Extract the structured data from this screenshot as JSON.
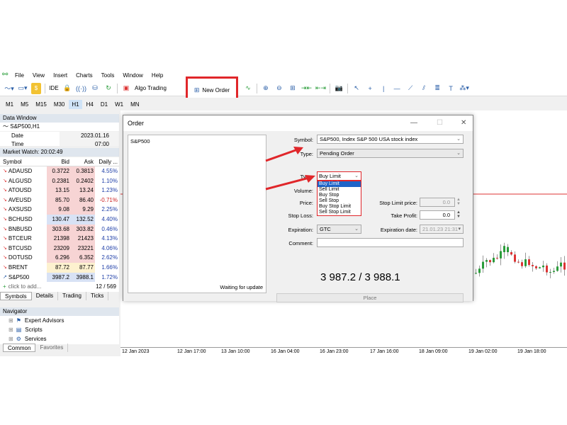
{
  "menu": [
    "File",
    "View",
    "Insert",
    "Charts",
    "Tools",
    "Window",
    "Help"
  ],
  "toolbar": {
    "ide_label": "IDE",
    "algo_label": "Algo Trading",
    "new_order_label": "New Order"
  },
  "timeframes": [
    "M1",
    "M5",
    "M15",
    "M30",
    "H1",
    "H4",
    "D1",
    "W1",
    "MN"
  ],
  "data_window": {
    "title": "Data Window",
    "symbol": "S&P500,H1",
    "rows": [
      {
        "k": "Date",
        "v": "2023.01.16"
      },
      {
        "k": "Time",
        "v": "07:00"
      }
    ]
  },
  "market_watch": {
    "title": "Market Watch: 20:02:49",
    "headers": {
      "symbol": "Symbol",
      "bid": "Bid",
      "ask": "Ask",
      "daily": "Daily ..."
    },
    "rows": [
      {
        "symbol": "ADAUSD",
        "bid": "0.3722",
        "ask": "0.3813",
        "daily": "4.55%",
        "dir": "down",
        "bg": "red"
      },
      {
        "symbol": "ALGUSD",
        "bid": "0.2381",
        "ask": "0.2402",
        "daily": "1.10%",
        "dir": "down",
        "bg": "red"
      },
      {
        "symbol": "ATOUSD",
        "bid": "13.15",
        "ask": "13.24",
        "daily": "1.23%",
        "dir": "down",
        "bg": "red"
      },
      {
        "symbol": "AVEUSD",
        "bid": "85.70",
        "ask": "86.40",
        "daily": "-0.71%",
        "dir": "down",
        "bg": "red"
      },
      {
        "symbol": "AXSUSD",
        "bid": "9.08",
        "ask": "9.29",
        "daily": "2.25%",
        "dir": "down",
        "bg": "red"
      },
      {
        "symbol": "BCHUSD",
        "bid": "130.47",
        "ask": "132.52",
        "daily": "4.40%",
        "dir": "down",
        "bg": "blue"
      },
      {
        "symbol": "BNBUSD",
        "bid": "303.68",
        "ask": "303.82",
        "daily": "0.46%",
        "dir": "down",
        "bg": "red"
      },
      {
        "symbol": "BTCEUR",
        "bid": "21398",
        "ask": "21423",
        "daily": "4.13%",
        "dir": "down",
        "bg": "red"
      },
      {
        "symbol": "BTCUSD",
        "bid": "23209",
        "ask": "23221",
        "daily": "4.06%",
        "dir": "down",
        "bg": "red"
      },
      {
        "symbol": "DOTUSD",
        "bid": "6.296",
        "ask": "6.352",
        "daily": "2.62%",
        "dir": "down",
        "bg": "red"
      },
      {
        "symbol": "BRENT",
        "bid": "87.72",
        "ask": "87.77",
        "daily": "1.66%",
        "dir": "down",
        "bg": "yellow"
      },
      {
        "symbol": "S&P500",
        "bid": "3987.2",
        "ask": "3988.1",
        "daily": "1.72%",
        "dir": "up",
        "bg": "blue"
      }
    ],
    "add_label": "click to add...",
    "count": "12 / 569",
    "tabs": [
      "Symbols",
      "Details",
      "Trading",
      "Ticks"
    ]
  },
  "navigator": {
    "title": "Navigator",
    "items": [
      "Expert Advisors",
      "Scripts",
      "Services"
    ],
    "tabs": [
      "Common",
      "Favorites"
    ]
  },
  "xaxis": [
    "12 Jan 2023",
    "12 Jan 17:00",
    "13 Jan 10:00",
    "16 Jan 04:00",
    "16 Jan 23:00",
    "17 Jan 16:00",
    "18 Jan 09:00",
    "19 Jan 02:00",
    "19 Jan 18:00"
  ],
  "order": {
    "title": "Order",
    "tick_symbol": "S&P500",
    "waiting": "Waiting for update",
    "symbol_label": "Symbol:",
    "symbol_value": "S&P500, Index S&P 500 USA stock index",
    "type_label": "Type:",
    "type_value": "Pending Order",
    "type2_label": "Type:",
    "type2_value": "Buy Limit",
    "type_options": [
      "Buy Limit",
      "Sell Limit",
      "Buy Stop",
      "Sell Stop",
      "Buy Stop Limit",
      "Sell Stop Limit"
    ],
    "volume_label": "Volume:",
    "price_label": "Price:",
    "stop_loss_label": "Stop Loss:",
    "stop_limit_label": "Stop Limit price:",
    "stop_limit_value": "0.0",
    "take_profit_label": "Take Profit:",
    "take_profit_value": "0.0",
    "expiration_label": "Expiration:",
    "expiration_value": "GTC",
    "exp_date_label": "Expiration date:",
    "exp_date_value": "21.01.23 21:31",
    "comment_label": "Comment:",
    "quote": "3 987.2 / 3 988.1",
    "place_label": "Place"
  },
  "colors": {
    "highlight": "#e0262a",
    "bull": "#2a9d3a",
    "bear": "#d33"
  }
}
